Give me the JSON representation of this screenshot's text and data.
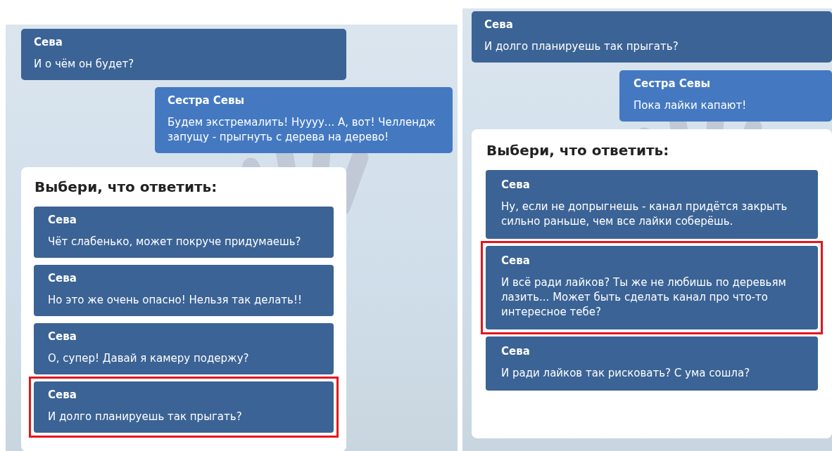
{
  "panels": [
    {
      "messages": [
        {
          "speaker": "Сева",
          "text": "И о чём он будет?",
          "kind": "incoming"
        },
        {
          "speaker": "Сестра Севы",
          "text": "Будем экстремалить! Нуууу... А, вот! Челлендж запущу - прыгнуть с дерева на дерево!",
          "kind": "outgoing"
        }
      ],
      "choices": {
        "prompt": "Выбери, что ответить:",
        "options": [
          {
            "speaker": "Сева",
            "text": "Чёт слабенько, может покруче придумаешь?",
            "highlighted": false
          },
          {
            "speaker": "Сева",
            "text": "Но это же очень опасно! Нельзя так делать!!",
            "highlighted": false
          },
          {
            "speaker": "Сева",
            "text": "О, супер! Давай я камеру подержу?",
            "highlighted": false
          },
          {
            "speaker": "Сева",
            "text": "И долго планируешь так прыгать?",
            "highlighted": true
          }
        ]
      }
    },
    {
      "messages": [
        {
          "speaker": "Сева",
          "text": "И долго планируешь так прыгать?",
          "kind": "incoming"
        },
        {
          "speaker": "Сестра Севы",
          "text": "Пока лайки капают!",
          "kind": "outgoing"
        }
      ],
      "choices": {
        "prompt": "Выбери, что ответить:",
        "options": [
          {
            "speaker": "Сева",
            "text": "Ну, если не допрыгнешь - канал придётся закрыть сильно раньше, чем все лайки соберёшь.",
            "highlighted": false
          },
          {
            "speaker": "Сева",
            "text": "И всё ради лайков? Ты же не любишь по деревьям лазить... Может быть сделать канал про что-то интересное тебе?",
            "highlighted": true
          },
          {
            "speaker": "Сева",
            "text": "И ради лайков так рисковать? С ума сошла?",
            "highlighted": false
          }
        ]
      }
    }
  ]
}
